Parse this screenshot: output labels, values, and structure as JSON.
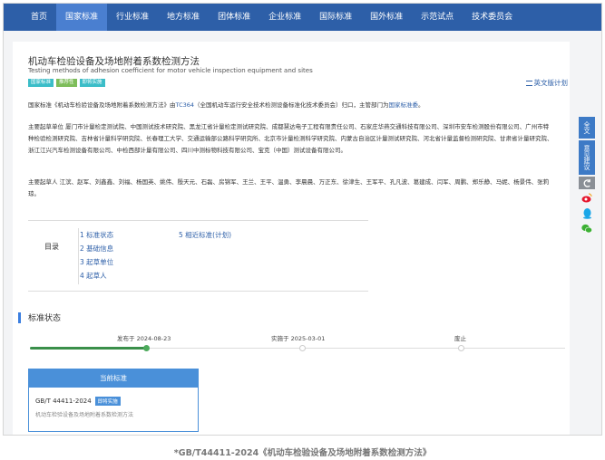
{
  "nav": {
    "items": [
      "首页",
      "国家标准",
      "行业标准",
      "地方标准",
      "团体标准",
      "企业标准",
      "国际标准",
      "国外标准",
      "示范试点",
      "技术委员会"
    ]
  },
  "standard": {
    "title_cn": "机动车检验设备及场地附着系数检测方法",
    "title_en": "Testing methods of adhesion coefficient for motor vehicle inspection equipment and sites",
    "tags": [
      "国家标准",
      "推荐性",
      "即将实施"
    ],
    "plan_link": "英文版计划"
  },
  "intro": {
    "part1": "国家标准《机动车检验设备及场地附着系数检测方法》由",
    "tc_code": "TC364",
    "part2": "（全国机动车运行安全技术检测设备标准化技术委员会）归口，主管部门为",
    "dept": "国家标准委",
    "part3": "。"
  },
  "drafting_units": {
    "text": "主要起草单位 厦门市计量检定测试院、中国测试技术研究院、黑龙江省计量检定测试研究院、成都慧达电子工程有限责任公司、石家庄华燕交通科技有限公司、深圳市安车检测股份有限公司、广州市特种检验检测研究院、吉林省计量科学研究院、长春理工大学、交通运输部公路科学研究所、北京市计量检测科学研究院、内蒙古自治区计量测试研究院、河北省计量监督检测研究院、甘肃省计量研究院、浙江江兴汽车检测设备有限公司、中检西部计量有限公司、四川中测标物科技有限公司、宝克（中国）测试设备有限公司。"
  },
  "drafters": {
    "text": "主要起草人 江滨、赵军、刘鑫鑫、刘福、杨国英、姚伟、殷天元、石磊、房锦军、王兰、王平、温勇、李晨晨、万正东、徐津生、王军平、孔凡波、葛建成、闫军、周鹏、郑乐静、马妮、杨景伟、张莉琼。"
  },
  "toc": {
    "label": "目录",
    "items": [
      "1 标准状态",
      "2 基础信息",
      "3 起草单位",
      "4 起草人",
      "5 相近标准(计划)"
    ]
  },
  "status": {
    "section_title": "标准状态",
    "published": "发布于 2024-08-23",
    "implemented": "实施于 2025-03-01",
    "abolished": "废止"
  },
  "current": {
    "header": "当前标准",
    "code": "GB/T 44411-2024",
    "badge": "即将实施",
    "desc": "机动车检验设备及场地附着系数检测方法"
  },
  "side": {
    "fulltext": "全文",
    "feedback": "意见建议"
  },
  "caption": "*GB/T44411-2024《机动车检验设备及场地附着系数检测方法》"
}
